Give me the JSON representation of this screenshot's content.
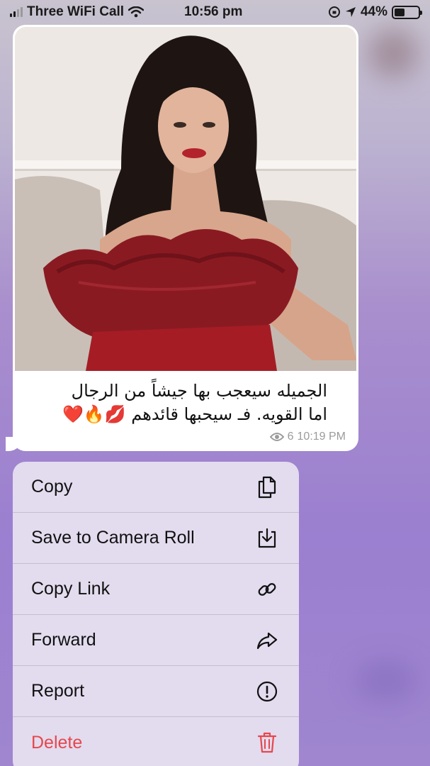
{
  "status_bar": {
    "carrier": "Three WiFi Call",
    "time": "10:56 pm",
    "battery": "44%",
    "battery_level": 0.44
  },
  "message": {
    "caption_line1": "الجميله سيعجب بها جيشاً من الرجال",
    "caption_line2": "اما القويه. فـ سيحبها قائدهم 💋🔥❤️",
    "views": "6",
    "time": "10:19 PM"
  },
  "menu": {
    "items": [
      {
        "label": "Copy",
        "icon": "copy-icon"
      },
      {
        "label": "Save to Camera Roll",
        "icon": "save-download-icon"
      },
      {
        "label": "Copy Link",
        "icon": "link-icon"
      },
      {
        "label": "Forward",
        "icon": "forward-arrow-icon"
      },
      {
        "label": "Report",
        "icon": "exclamation-circle-icon"
      },
      {
        "label": "Delete",
        "icon": "trash-icon"
      }
    ],
    "colors": {
      "danger": "#e5484d",
      "text": "#111111"
    }
  }
}
